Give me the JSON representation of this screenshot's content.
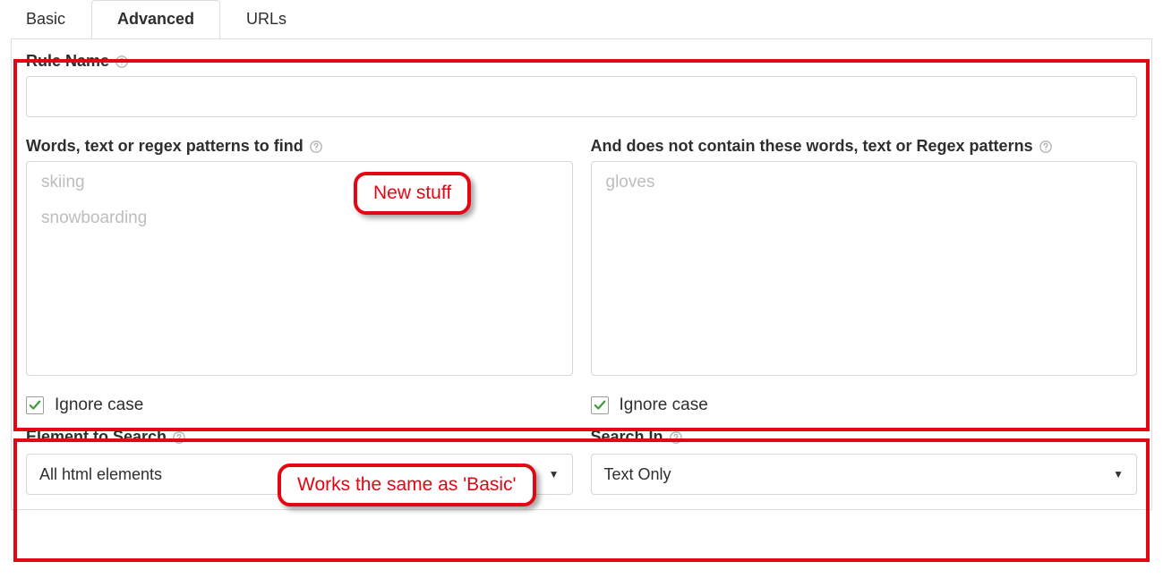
{
  "tabs": {
    "basic": "Basic",
    "advanced": "Advanced",
    "urls": "URLs",
    "active": "advanced"
  },
  "form": {
    "ruleName": {
      "label": "Rule Name",
      "value": ""
    },
    "find": {
      "label": "Words, text or regex patterns to find",
      "tags": [
        "skiing",
        "snowboarding"
      ]
    },
    "exclude": {
      "label": "And does not contain these words, text or Regex patterns",
      "tags": [
        "gloves"
      ]
    },
    "left": {
      "ignoreCase": {
        "label": "Ignore case",
        "checked": true
      },
      "elementToSearch": {
        "label": "Element to Search",
        "value": "All html elements"
      }
    },
    "right": {
      "ignoreCase": {
        "label": "Ignore case",
        "checked": true
      },
      "searchIn": {
        "label": "Search In",
        "value": "Text Only"
      }
    }
  },
  "annotations": {
    "callout1": "New stuff",
    "callout2": "Works the same as 'Basic'"
  }
}
